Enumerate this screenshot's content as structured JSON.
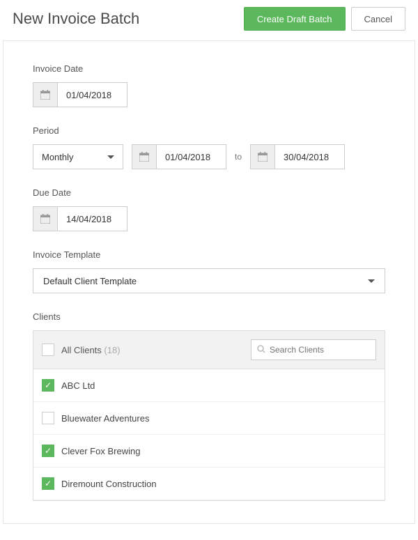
{
  "header": {
    "title": "New Invoice Batch",
    "create_label": "Create Draft Batch",
    "cancel_label": "Cancel"
  },
  "invoice_date": {
    "label": "Invoice Date",
    "value": "01/04/2018"
  },
  "period": {
    "label": "Period",
    "frequency": "Monthly",
    "from": "01/04/2018",
    "to_label": "to",
    "to": "30/04/2018"
  },
  "due_date": {
    "label": "Due Date",
    "value": "14/04/2018"
  },
  "template": {
    "label": "Invoice Template",
    "value": "Default Client Template"
  },
  "clients": {
    "label": "Clients",
    "all_label": "All Clients",
    "count": "(18)",
    "search_placeholder": "Search Clients",
    "items": [
      {
        "name": "ABC Ltd",
        "checked": true
      },
      {
        "name": "Bluewater Adventures",
        "checked": false
      },
      {
        "name": "Clever Fox Brewing",
        "checked": true
      },
      {
        "name": "Diremount Construction",
        "checked": true
      }
    ]
  }
}
